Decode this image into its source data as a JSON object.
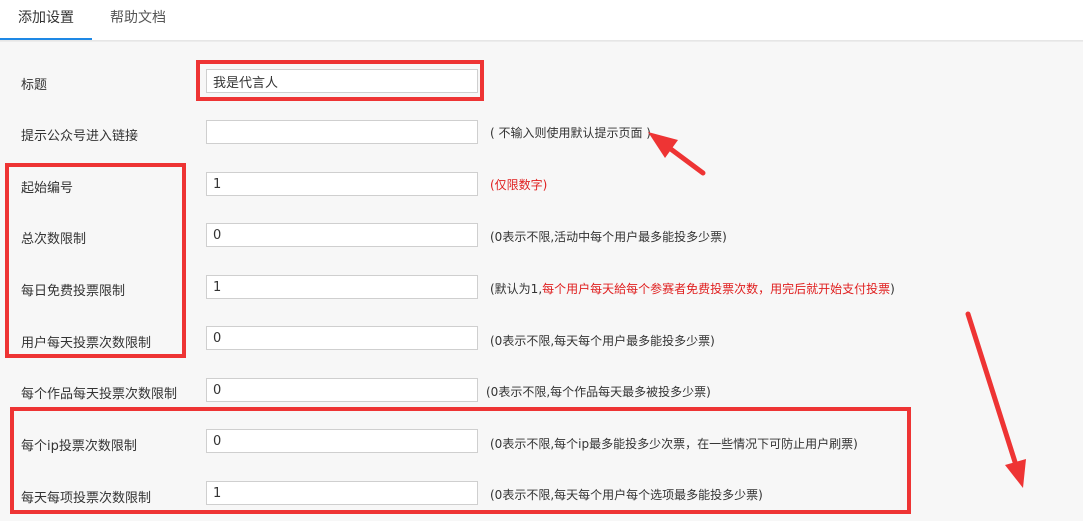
{
  "tabs": [
    {
      "label": "添加设置",
      "active": true
    },
    {
      "label": "帮助文档",
      "active": false
    }
  ],
  "fields": {
    "title": {
      "label": "标题",
      "value": "我是代言人"
    },
    "entry_link": {
      "label": "提示公众号进入链接",
      "value": "",
      "hint": "( 不输入则使用默认提示页面 )"
    },
    "start_number": {
      "label": "起始编号",
      "value": "1",
      "hint": "(仅限数字)"
    },
    "total_limit": {
      "label": "总次数限制",
      "value": "0",
      "hint": "(0表示不限,活动中每个用户最多能投多少票)"
    },
    "daily_free_limit": {
      "label": "每日免费投票限制",
      "value": "1",
      "hint_prefix": "(默认为1,",
      "hint_red": "每个用户每天給每个参赛者免费投票次数，用完后就开始支付投票",
      "hint_suffix": ")"
    },
    "user_daily_limit": {
      "label": "用户每天投票次数限制",
      "value": "0",
      "hint": "(0表示不限,每天每个用户最多能投多少票)"
    },
    "work_daily_limit": {
      "label": "每个作品每天投票次数限制",
      "value": "0",
      "hint": "(0表示不限,每个作品每天最多被投多少票)"
    },
    "ip_limit": {
      "label": "每个ip投票次数限制",
      "value": "0",
      "hint": "(0表示不限,每个ip最多能投多少次票，在一些情况下可防止用户刷票)"
    },
    "item_daily_limit": {
      "label": "每天每项投票次数限制",
      "value": "1",
      "hint": "(0表示不限,每天每个用户每个选项最多能投多少票)"
    }
  },
  "colors": {
    "accent": "#1e88e5",
    "annotation": "#ee3434",
    "hint_red": "#e02020"
  }
}
